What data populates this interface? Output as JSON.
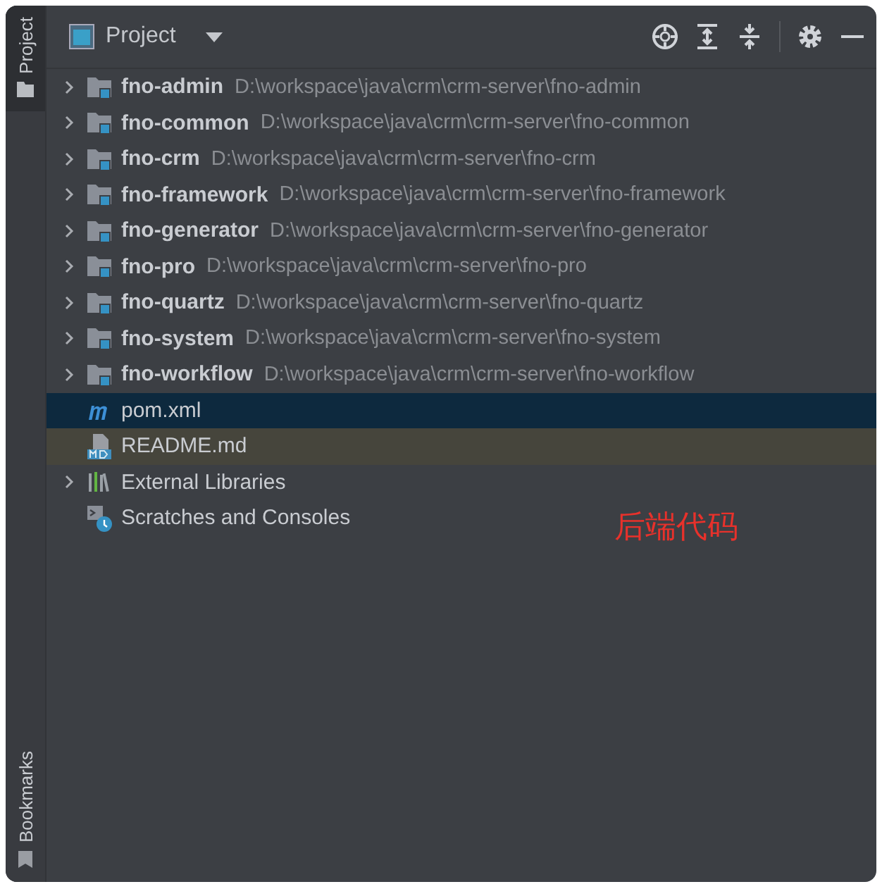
{
  "side_tabs": {
    "top": {
      "label": "Project",
      "selected": true
    },
    "bottom": {
      "label": "Bookmarks",
      "selected": false
    }
  },
  "header": {
    "title": "Project"
  },
  "tree": [
    {
      "kind": "module",
      "name": "fno-admin",
      "path": "D:\\workspace\\java\\crm\\crm-server\\fno-admin",
      "expanded": false,
      "selected": false
    },
    {
      "kind": "module",
      "name": "fno-common",
      "path": "D:\\workspace\\java\\crm\\crm-server\\fno-common",
      "expanded": false,
      "selected": false
    },
    {
      "kind": "module",
      "name": "fno-crm",
      "path": "D:\\workspace\\java\\crm\\crm-server\\fno-crm",
      "expanded": false,
      "selected": false
    },
    {
      "kind": "module",
      "name": "fno-framework",
      "path": "D:\\workspace\\java\\crm\\crm-server\\fno-framework",
      "expanded": false,
      "selected": false
    },
    {
      "kind": "module",
      "name": "fno-generator",
      "path": "D:\\workspace\\java\\crm\\crm-server\\fno-generator",
      "expanded": false,
      "selected": false
    },
    {
      "kind": "module",
      "name": "fno-pro",
      "path": "D:\\workspace\\java\\crm\\crm-server\\fno-pro",
      "expanded": false,
      "selected": false
    },
    {
      "kind": "module",
      "name": "fno-quartz",
      "path": "D:\\workspace\\java\\crm\\crm-server\\fno-quartz",
      "expanded": false,
      "selected": false
    },
    {
      "kind": "module",
      "name": "fno-system",
      "path": "D:\\workspace\\java\\crm\\crm-server\\fno-system",
      "expanded": false,
      "selected": false
    },
    {
      "kind": "module",
      "name": "fno-workflow",
      "path": "D:\\workspace\\java\\crm\\crm-server\\fno-workflow",
      "expanded": false,
      "selected": false
    },
    {
      "kind": "maven",
      "name": "pom.xml",
      "selected": true
    },
    {
      "kind": "markdown",
      "name": "README.md",
      "selected": false,
      "hovered": true
    },
    {
      "kind": "libraries",
      "name": "External Libraries",
      "expanded": false,
      "selected": false
    },
    {
      "kind": "scratches",
      "name": "Scratches and Consoles",
      "selected": false
    }
  ],
  "annotation": "后端代码"
}
